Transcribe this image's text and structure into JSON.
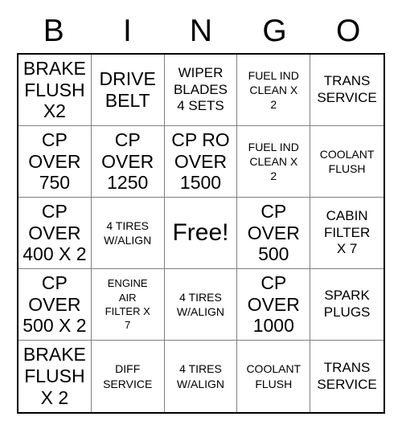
{
  "card": {
    "title": "BINGO",
    "header_letters": [
      "B",
      "I",
      "N",
      "G",
      "O"
    ],
    "columns": 5,
    "rows": 5,
    "free_space": {
      "row": 3,
      "column": 3,
      "label": "Free!"
    },
    "colors": {
      "background": "#ffffff",
      "text": "#000000",
      "outer_border": "#000000",
      "inner_border": "#808080"
    },
    "cells": [
      [
        {
          "text": "BRAKE\nFLUSH\nX2",
          "size": "lg",
          "free": false
        },
        {
          "text": "DRIVE\nBELT",
          "size": "lg",
          "free": false
        },
        {
          "text": "WIPER\nBLADES\n4 SETS",
          "size": "md",
          "free": false
        },
        {
          "text": "FUEL IND\nCLEAN X\n2",
          "size": "sm",
          "free": false
        },
        {
          "text": "TRANS\nSERVICE",
          "size": "md",
          "free": false
        }
      ],
      [
        {
          "text": "CP\nOVER\n750",
          "size": "lg",
          "free": false
        },
        {
          "text": "CP\nOVER\n1250",
          "size": "lg",
          "free": false
        },
        {
          "text": "CP RO\nOVER\n1500",
          "size": "lg",
          "free": false
        },
        {
          "text": "FUEL IND\nCLEAN X\n2",
          "size": "sm",
          "free": false
        },
        {
          "text": "COOLANT\nFLUSH",
          "size": "sm",
          "free": false
        }
      ],
      [
        {
          "text": "CP\nOVER\n400 X 2",
          "size": "lg",
          "free": false
        },
        {
          "text": "4 TIRES\nW/ALIGN",
          "size": "sm",
          "free": false
        },
        {
          "text": "Free!",
          "size": "xl",
          "free": true
        },
        {
          "text": "CP\nOVER\n500",
          "size": "lg",
          "free": false
        },
        {
          "text": "CABIN\nFILTER\nX 7",
          "size": "md",
          "free": false
        }
      ],
      [
        {
          "text": "CP\nOVER\n500 X 2",
          "size": "lg",
          "free": false
        },
        {
          "text": "ENGINE\nAIR\nFILTER X\n7",
          "size": "xs",
          "free": false
        },
        {
          "text": "4 TIRES\nW/ALIGN",
          "size": "sm",
          "free": false
        },
        {
          "text": "CP\nOVER\n1000",
          "size": "lg",
          "free": false
        },
        {
          "text": "SPARK\nPLUGS",
          "size": "md",
          "free": false
        }
      ],
      [
        {
          "text": "BRAKE\nFLUSH\nX 2",
          "size": "lg",
          "free": false
        },
        {
          "text": "DIFF\nSERVICE",
          "size": "sm",
          "free": false
        },
        {
          "text": "4 TIRES\nW/ALIGN",
          "size": "sm",
          "free": false
        },
        {
          "text": "COOLANT\nFLUSH",
          "size": "sm",
          "free": false
        },
        {
          "text": "TRANS\nSERVICE",
          "size": "md",
          "free": false
        }
      ]
    ]
  }
}
